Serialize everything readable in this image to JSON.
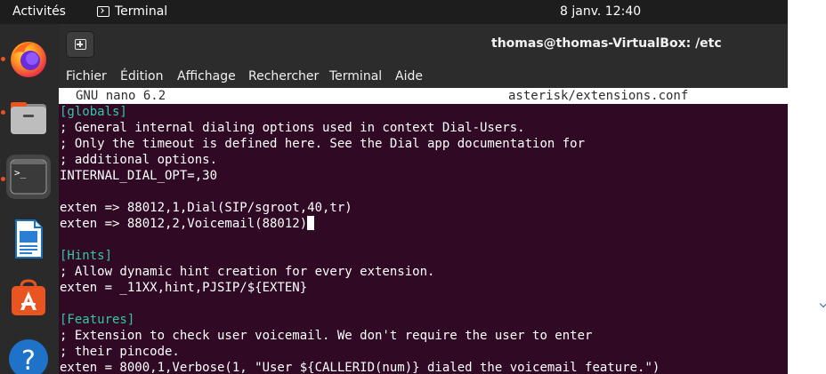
{
  "topbar": {
    "activities": "Activités",
    "app_name": "Terminal",
    "clock": "8 janv.  12:40",
    "app_icon": "terminal-icon"
  },
  "dock": {
    "items": [
      {
        "name": "firefox",
        "icon": "firefox-icon",
        "running": true
      },
      {
        "name": "files",
        "icon": "files-icon",
        "running": true
      },
      {
        "name": "terminal",
        "icon": "terminal-icon",
        "running": true,
        "active": true
      },
      {
        "name": "libreoffice-writer",
        "icon": "writer-icon",
        "running": false
      },
      {
        "name": "ubuntu-software",
        "icon": "software-icon",
        "running": false
      },
      {
        "name": "help",
        "icon": "help-icon",
        "running": false
      }
    ]
  },
  "window": {
    "title": "thomas@thomas-VirtualBox: /etc",
    "new_tab_icon": "new-tab-icon",
    "menu": [
      "Fichier",
      "Édition",
      "Affichage",
      "Rechercher",
      "Terminal",
      "Aide"
    ]
  },
  "nano": {
    "version": "GNU nano 6.2",
    "filename": "asterisk/extensions.conf",
    "lines": [
      {
        "text": "[globals]",
        "kind": "section"
      },
      {
        "text": "; General internal dialing options used in context Dial-Users.",
        "kind": "comment"
      },
      {
        "text": "; Only the timeout is defined here. See the Dial app documentation for",
        "kind": "comment"
      },
      {
        "text": "; additional options.",
        "kind": "comment"
      },
      {
        "text": "INTERNAL_DIAL_OPT=,30",
        "kind": "code"
      },
      {
        "text": "",
        "kind": "blank"
      },
      {
        "text": "exten => 88012,1,Dial(SIP/sgroot,40,tr)",
        "kind": "code"
      },
      {
        "text": "exten => 88012,2,Voicemail(88012)",
        "kind": "code",
        "cursor": true
      },
      {
        "text": "",
        "kind": "blank"
      },
      {
        "text": "[Hints]",
        "kind": "section"
      },
      {
        "text": "; Allow dynamic hint creation for every extension.",
        "kind": "comment"
      },
      {
        "text": "exten = _11XX,hint,PJSIP/${EXTEN}",
        "kind": "code"
      },
      {
        "text": "",
        "kind": "blank"
      },
      {
        "text": "[Features]",
        "kind": "section"
      },
      {
        "text": "; Extension to check user voicemail. We don't require the user to enter",
        "kind": "comment"
      },
      {
        "text": "; their pincode.",
        "kind": "comment"
      },
      {
        "text": "exten = 8000,1,Verbose(1, \"User ${CALLERID(num)} dialed the voicemail feature.\")",
        "kind": "code"
      }
    ]
  },
  "colors": {
    "terminal_bg": "#300a24",
    "section": "#33c7a5",
    "accent_running": "#e95420"
  }
}
